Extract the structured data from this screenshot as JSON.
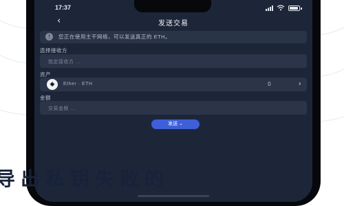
{
  "status": {
    "time": "17:37"
  },
  "nav": {
    "title": "发送交易",
    "back_icon": "chevron-left-icon"
  },
  "notice": {
    "icon": "info-icon",
    "text": "您正在使用主干网络，可以发送真正的 ETH。"
  },
  "fields": {
    "network": {
      "label": "选择接收方",
      "placeholder": "指定接收方 ..."
    },
    "asset": {
      "label": "资产",
      "name": "Ether · ETH",
      "balance": "0"
    },
    "amount": {
      "label": "金额",
      "placeholder": "交易金额 ..."
    }
  },
  "send_button": {
    "label": "发送 ⌄"
  },
  "banner": {
    "text": "导出私钥失败的"
  },
  "colors": {
    "screen_bg": "#1d2639",
    "field_bg": "#2b3448",
    "accent": "#3d5fd9",
    "banner_text": "#17223a"
  }
}
